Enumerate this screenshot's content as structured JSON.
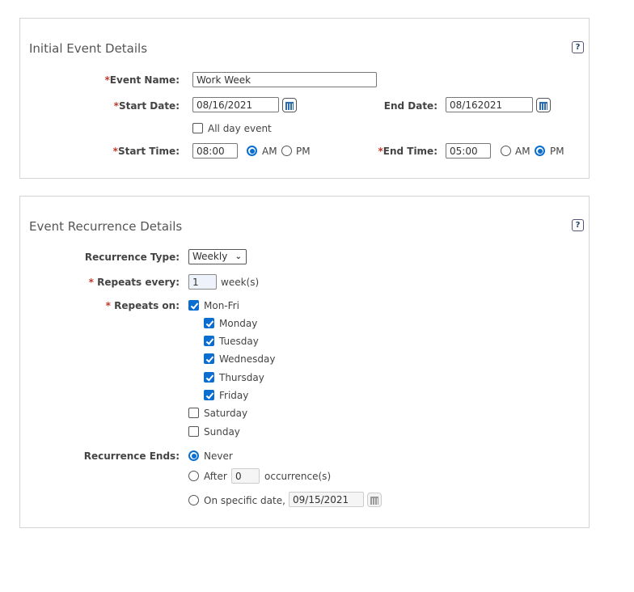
{
  "initial": {
    "title": "Initial Event Details",
    "help": "?",
    "event_name_label": "Event Name:",
    "event_name": "Work Week",
    "start_date_label": "Start Date:",
    "start_date": "08/16/2021",
    "end_date_label": "End Date:",
    "end_date": "08/162021",
    "all_day_label": "All day event",
    "all_day": false,
    "start_time_label": "Start Time:",
    "start_time": "08:00",
    "end_time_label": "End Time:",
    "end_time": "05:00",
    "am": "AM",
    "pm": "PM",
    "start_meridiem": "AM",
    "end_meridiem": "PM",
    "required": "*"
  },
  "recurrence": {
    "title": "Event Recurrence Details",
    "help": "?",
    "type_label": "Recurrence Type:",
    "type": "Weekly",
    "repeats_every_label": "Repeats every:",
    "repeats_every": "1",
    "unit": "week(s)",
    "repeats_on_label": "Repeats on:",
    "required": "*",
    "days": [
      {
        "label": "Mon-Fri",
        "checked": true
      },
      {
        "label": "Monday",
        "checked": true
      },
      {
        "label": "Tuesday",
        "checked": true
      },
      {
        "label": "Wednesday",
        "checked": true
      },
      {
        "label": "Thursday",
        "checked": true
      },
      {
        "label": "Friday",
        "checked": true
      },
      {
        "label": "Saturday",
        "checked": false
      },
      {
        "label": "Sunday",
        "checked": false
      }
    ],
    "ends_label": "Recurrence Ends:",
    "never": "Never",
    "after": "After",
    "after_count": "0",
    "occurrences": "occurrence(s)",
    "on_date_label": "On specific date,",
    "on_date": "09/15/2021",
    "ends_selected": "Never"
  }
}
